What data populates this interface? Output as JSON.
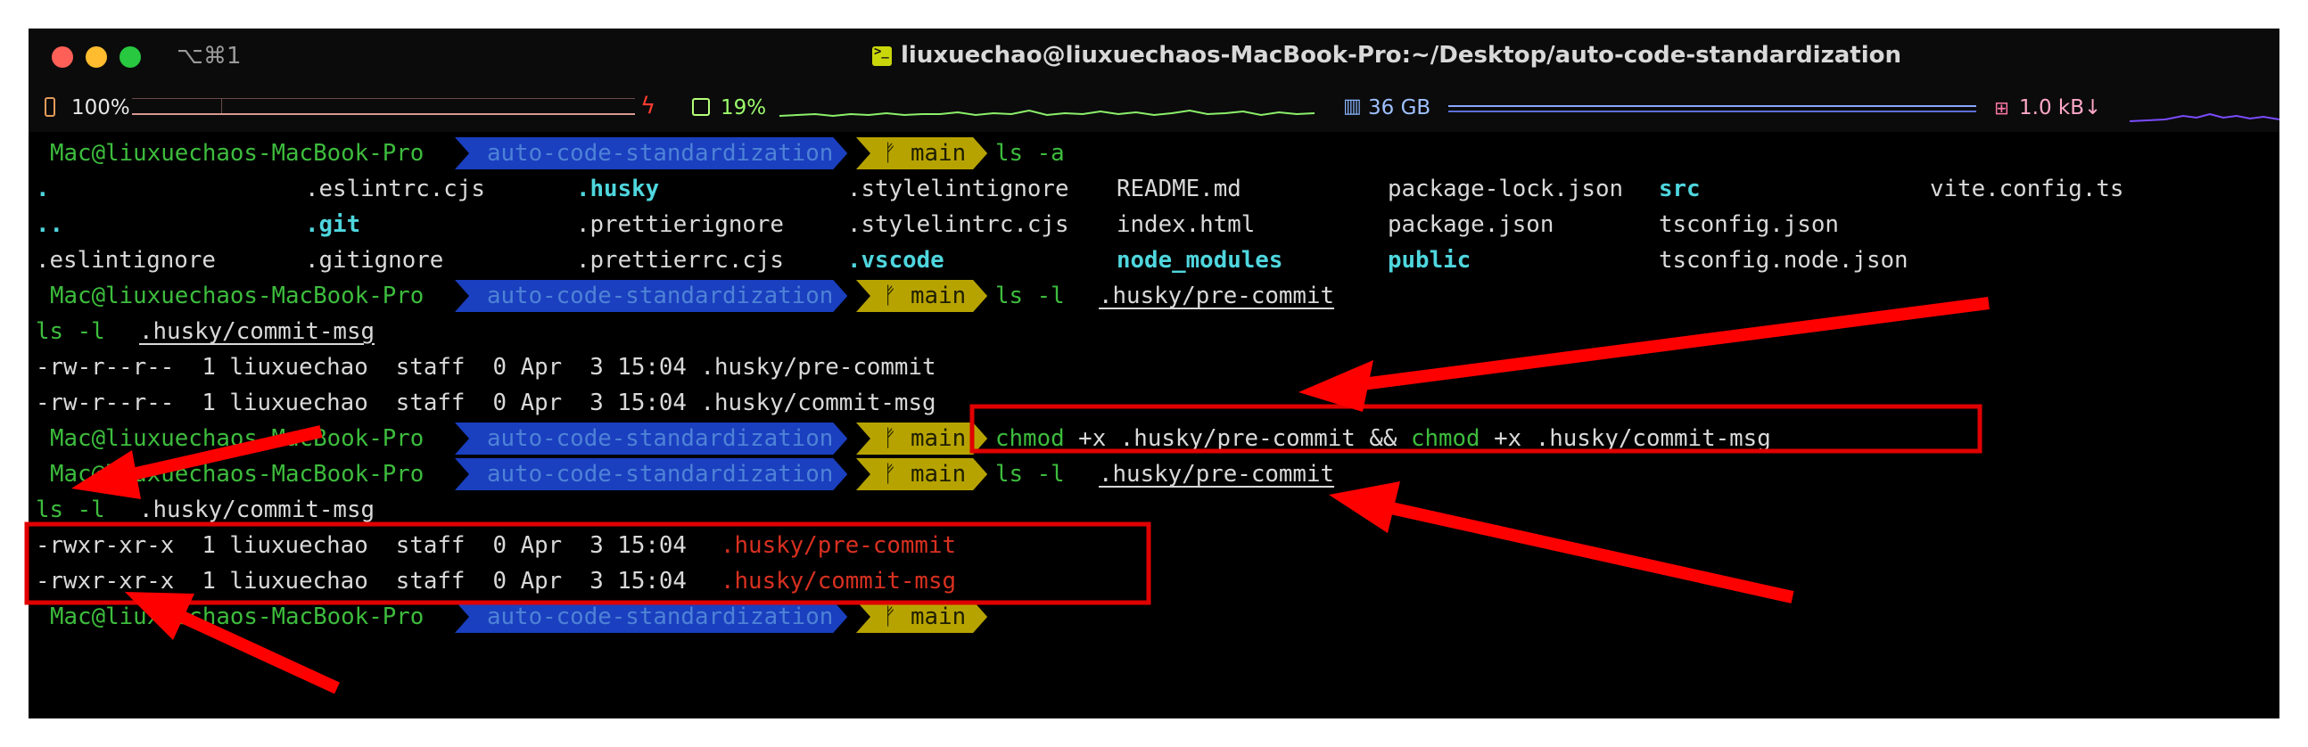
{
  "window": {
    "shortcut": "⌥⌘1",
    "title": "liuxuechao@liuxuechaos-MacBook-Pro:~/Desktop/auto-code-standardization"
  },
  "status": {
    "battery": "100%",
    "cpu": "19%",
    "memory": "36 GB",
    "network": "1.0 kB↓"
  },
  "prompt": {
    "user": "Mac@liuxuechaos-MacBook-Pro",
    "dir": "auto-code-standardization",
    "branch": "ᚠ main"
  },
  "commands": {
    "ls_a": "ls -a",
    "ls_l": "ls -l",
    "pre_commit": ".husky/pre-commit",
    "commit_msg": ".husky/commit-msg",
    "chmod": "chmod",
    "chmod_arg1": " +x .husky/pre-commit && ",
    "chmod_arg2": " +x .husky/commit-msg"
  },
  "ls_entries": {
    "col1": [
      ".",
      "..",
      ".eslintignore"
    ],
    "col2": [
      ".eslintrc.cjs",
      ".git",
      ".gitignore"
    ],
    "col3": [
      ".husky",
      ".prettierignore",
      ".prettierrc.cjs"
    ],
    "col4": [
      ".stylelintignore",
      ".stylelintrc.cjs",
      ".vscode"
    ],
    "col5": [
      "README.md",
      "index.html",
      "node_modules"
    ],
    "col6": [
      "package-lock.json",
      "package.json",
      "public"
    ],
    "col7": [
      "src",
      "tsconfig.json",
      "tsconfig.node.json"
    ],
    "col8": [
      "vite.config.ts"
    ]
  },
  "listings": {
    "before_1": "-rw-r--r--  1 liuxuechao  staff  0 Apr  3 15:04 .husky/pre-commit",
    "before_2": "-rw-r--r--  1 liuxuechao  staff  0 Apr  3 15:04 .husky/commit-msg",
    "after_prefix": "-rwxr-xr-x  1 liuxuechao  staff  0 Apr  3 15:04 ",
    "after_1_file": ".husky/pre-commit",
    "after_2_file": ".husky/commit-msg"
  },
  "colors": {
    "user": "#3dbc3d",
    "dir_bg": "#1a3fbf",
    "branch_bg": "#b7a300",
    "executable": "#d83020",
    "directory": "#4fd6de",
    "annotation": "#ff0000"
  }
}
